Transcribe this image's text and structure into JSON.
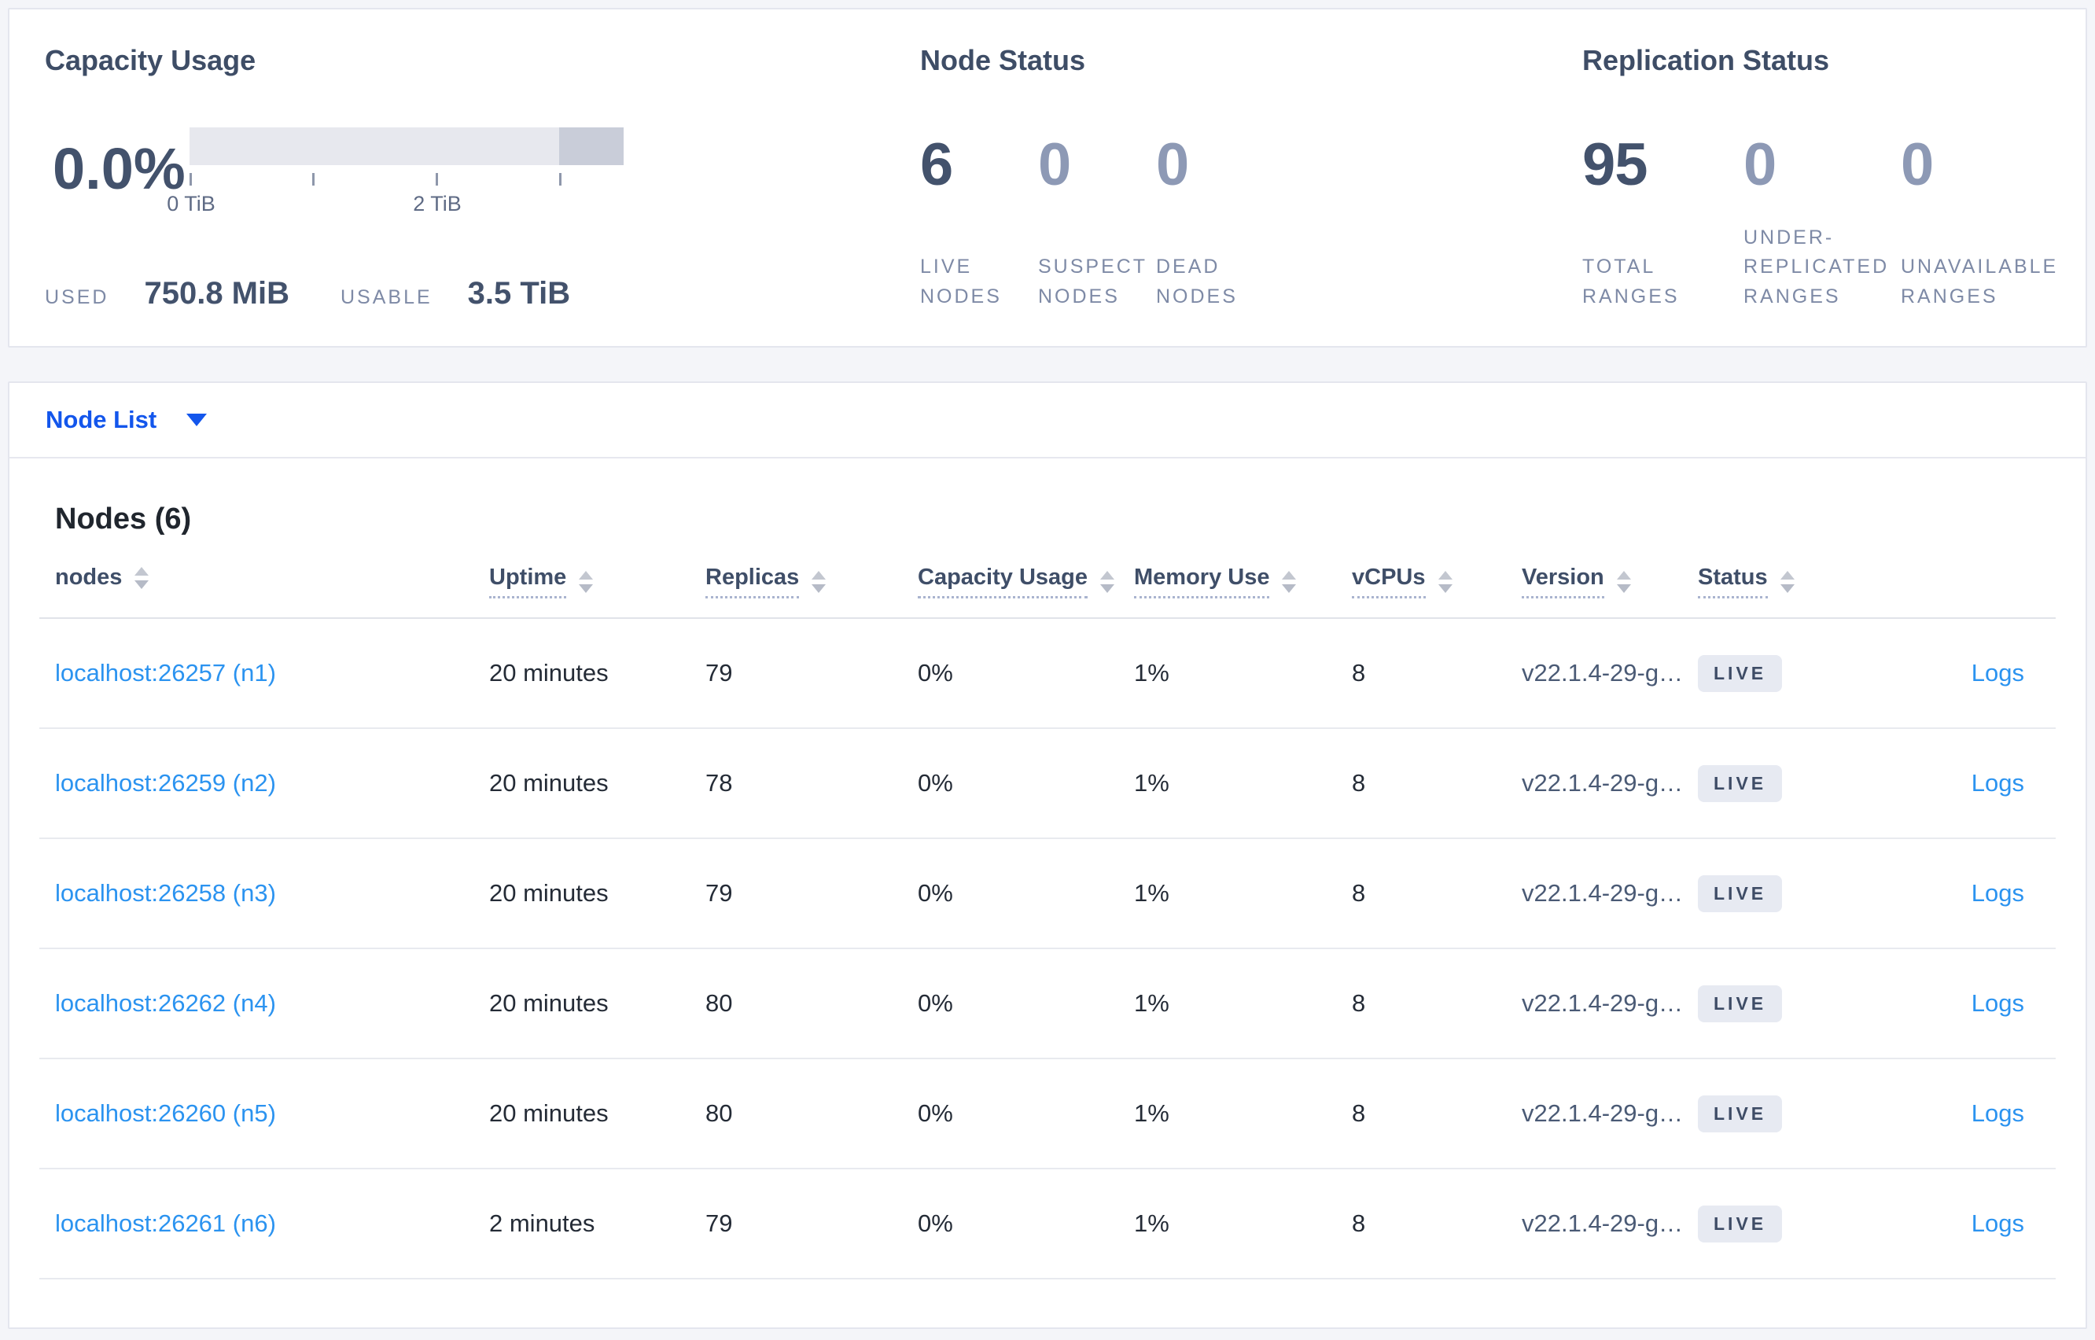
{
  "colors": {
    "page-bg": "#f4f5f9",
    "card-border": "#e4e6ee",
    "title-slate": "#3e4d66",
    "number-dark": "#43526c",
    "number-dim": "#8d99b5",
    "label-muted": "#7e8aa6",
    "bar-light": "#e7e8ee",
    "bar-dark": "#c9cdd9",
    "row-link": "#2b93f0",
    "dropdown-blue": "#1356ec",
    "badge-bg": "#e7eaf2",
    "badge-text": "#3e4c66",
    "cell-text": "#242b36",
    "header-text": "#3f4e68",
    "divider": "#e8eaef"
  },
  "capacity_usage": {
    "title": "Capacity Usage",
    "percent": "0.0%",
    "tick_labels": [
      "0 TiB",
      "2 TiB"
    ],
    "used_label": "USED",
    "used_value": "750.8 MiB",
    "usable_label": "USABLE",
    "usable_value": "3.5 TiB"
  },
  "node_status": {
    "title": "Node Status",
    "metrics": [
      {
        "value": "6",
        "label": "LIVE NODES"
      },
      {
        "value": "0",
        "label": "SUSPECT NODES"
      },
      {
        "value": "0",
        "label": "DEAD NODES"
      }
    ]
  },
  "replication_status": {
    "title": "Replication Status",
    "metrics": [
      {
        "value": "95",
        "label": "TOTAL RANGES"
      },
      {
        "value": "0",
        "label": "UNDER-REPLICATED RANGES"
      },
      {
        "value": "0",
        "label": "UNAVAILABLE RANGES"
      }
    ]
  },
  "node_list": {
    "dropdown_label": "Node List",
    "heading": "Nodes (6)",
    "columns": [
      {
        "label": "nodes"
      },
      {
        "label": "Uptime"
      },
      {
        "label": "Replicas"
      },
      {
        "label": "Capacity Usage"
      },
      {
        "label": "Memory Use"
      },
      {
        "label": "vCPUs"
      },
      {
        "label": "Version"
      },
      {
        "label": "Status"
      }
    ],
    "rows": [
      {
        "node": "localhost:26257 (n1)",
        "uptime": "20 minutes",
        "replicas": "79",
        "capacity": "0%",
        "memory": "1%",
        "vcpus": "8",
        "version": "v22.1.4-29-g…",
        "status": "LIVE",
        "logs": "Logs"
      },
      {
        "node": "localhost:26259 (n2)",
        "uptime": "20 minutes",
        "replicas": "78",
        "capacity": "0%",
        "memory": "1%",
        "vcpus": "8",
        "version": "v22.1.4-29-g…",
        "status": "LIVE",
        "logs": "Logs"
      },
      {
        "node": "localhost:26258 (n3)",
        "uptime": "20 minutes",
        "replicas": "79",
        "capacity": "0%",
        "memory": "1%",
        "vcpus": "8",
        "version": "v22.1.4-29-g…",
        "status": "LIVE",
        "logs": "Logs"
      },
      {
        "node": "localhost:26262 (n4)",
        "uptime": "20 minutes",
        "replicas": "80",
        "capacity": "0%",
        "memory": "1%",
        "vcpus": "8",
        "version": "v22.1.4-29-g…",
        "status": "LIVE",
        "logs": "Logs"
      },
      {
        "node": "localhost:26260 (n5)",
        "uptime": "20 minutes",
        "replicas": "80",
        "capacity": "0%",
        "memory": "1%",
        "vcpus": "8",
        "version": "v22.1.4-29-g…",
        "status": "LIVE",
        "logs": "Logs"
      },
      {
        "node": "localhost:26261 (n6)",
        "uptime": "2 minutes",
        "replicas": "79",
        "capacity": "0%",
        "memory": "1%",
        "vcpus": "8",
        "version": "v22.1.4-29-g…",
        "status": "LIVE",
        "logs": "Logs"
      }
    ]
  }
}
